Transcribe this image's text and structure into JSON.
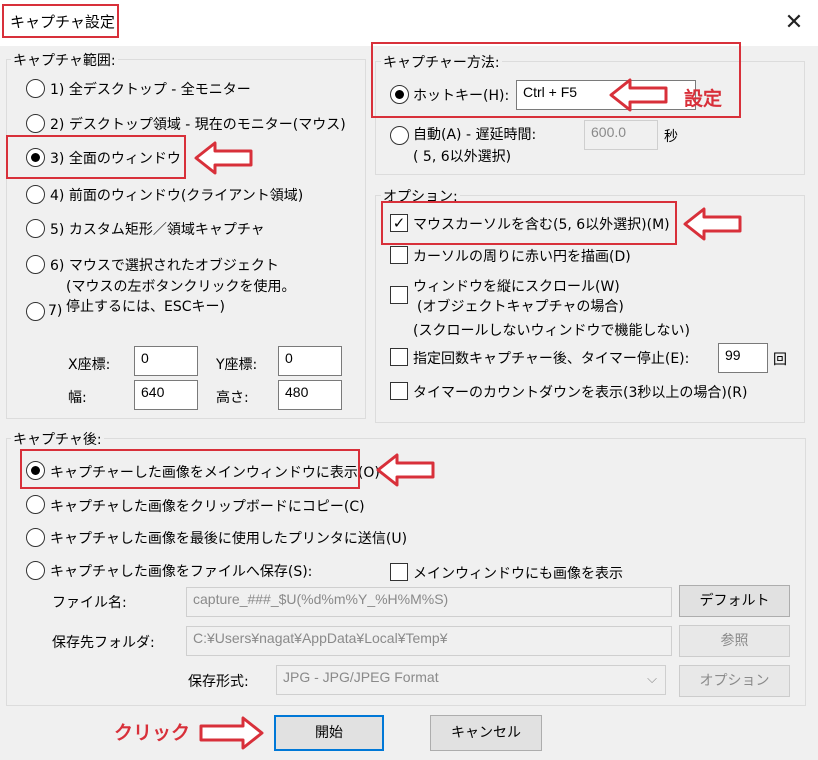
{
  "window": {
    "title": "キャプチャ設定",
    "close_glyph": "✕"
  },
  "capture_range": {
    "label": "キャプチャ範囲:",
    "options": [
      {
        "label": "1) 全デスクトップ - 全モニター",
        "selected": false
      },
      {
        "label": "2) デスクトップ領域 - 現在のモニター(マウス)",
        "selected": false
      },
      {
        "label": "3) 全面のウィンドウ",
        "selected": true
      },
      {
        "label": "4) 前面のウィンドウ(クライアント領域)",
        "selected": false
      },
      {
        "label": "5) カスタム矩形／領域キャプチャ",
        "selected": false
      },
      {
        "label": "6) マウスで選択されたオブジェクト",
        "selected": false
      },
      {
        "label": "7)",
        "selected": false
      }
    ],
    "object_note_1": "(マウスの左ボタンクリックを使用。",
    "object_note_2": "停止するには、ESCキー)",
    "x_label": "X座標:",
    "x_value": "0",
    "y_label": "Y座標:",
    "y_value": "0",
    "width_label": "幅:",
    "width_value": "640",
    "height_label": "高さ:",
    "height_value": "480"
  },
  "capture_method": {
    "label": "キャプチャー方法:",
    "hotkey_label": "ホットキー(H):",
    "hotkey_value": "Ctrl + F5",
    "hotkey_selected": true,
    "auto_label": "自動(A) - 遅延時間:",
    "auto_sub": "( 5, 6以外選択)",
    "delay_value": "600.0",
    "delay_unit": "秒"
  },
  "options": {
    "label": "オプション:",
    "include_cursor": {
      "label": "マウスカーソルを含む(5, 6以外選択)(M)",
      "checked": true
    },
    "red_circle": {
      "label": "カーソルの周りに赤い円を描画(D)",
      "checked": false
    },
    "scroll": {
      "label": "ウィンドウを縦にスクロール(W)",
      "sub1": "(オブジェクトキャプチャの場合)",
      "sub2": "(スクロールしないウィンドウで機能しない)",
      "checked": false
    },
    "timer_stop": {
      "label": "指定回数キャプチャー後、タイマー停止(E):",
      "checked": false,
      "value": "99",
      "unit": "回"
    },
    "countdown": {
      "label": "タイマーのカウントダウンを表示(3秒以上の場合)(R)",
      "checked": false
    }
  },
  "after_capture": {
    "label": "キャプチャ後:",
    "options": [
      {
        "label": "キャプチャーした画像をメインウィンドウに表示(O)",
        "selected": true
      },
      {
        "label": "キャプチャした画像をクリップボードにコピー(C)",
        "selected": false
      },
      {
        "label": "キャプチャした画像を最後に使用したプリンタに送信(U)",
        "selected": false
      },
      {
        "label": "キャプチャした画像をファイルへ保存(S):",
        "selected": false
      }
    ],
    "show_in_main": {
      "label": "メインウィンドウにも画像を表示",
      "checked": false
    },
    "filename_label": "ファイル名:",
    "filename_value": "capture_###_$U(%d%m%Y_%H%M%S)",
    "default_button": "デフォルト",
    "folder_label": "保存先フォルダ:",
    "folder_value": "C:¥Users¥nagat¥AppData¥Local¥Temp¥",
    "browse_button": "参照",
    "format_label": "保存形式:",
    "format_value": "JPG - JPG/JPEG Format",
    "options_button": "オプション"
  },
  "footer": {
    "start_button": "開始",
    "cancel_button": "キャンセル"
  },
  "annotations": {
    "setting_text": "設定",
    "click_text": "クリック",
    "color": "#d8303a"
  }
}
